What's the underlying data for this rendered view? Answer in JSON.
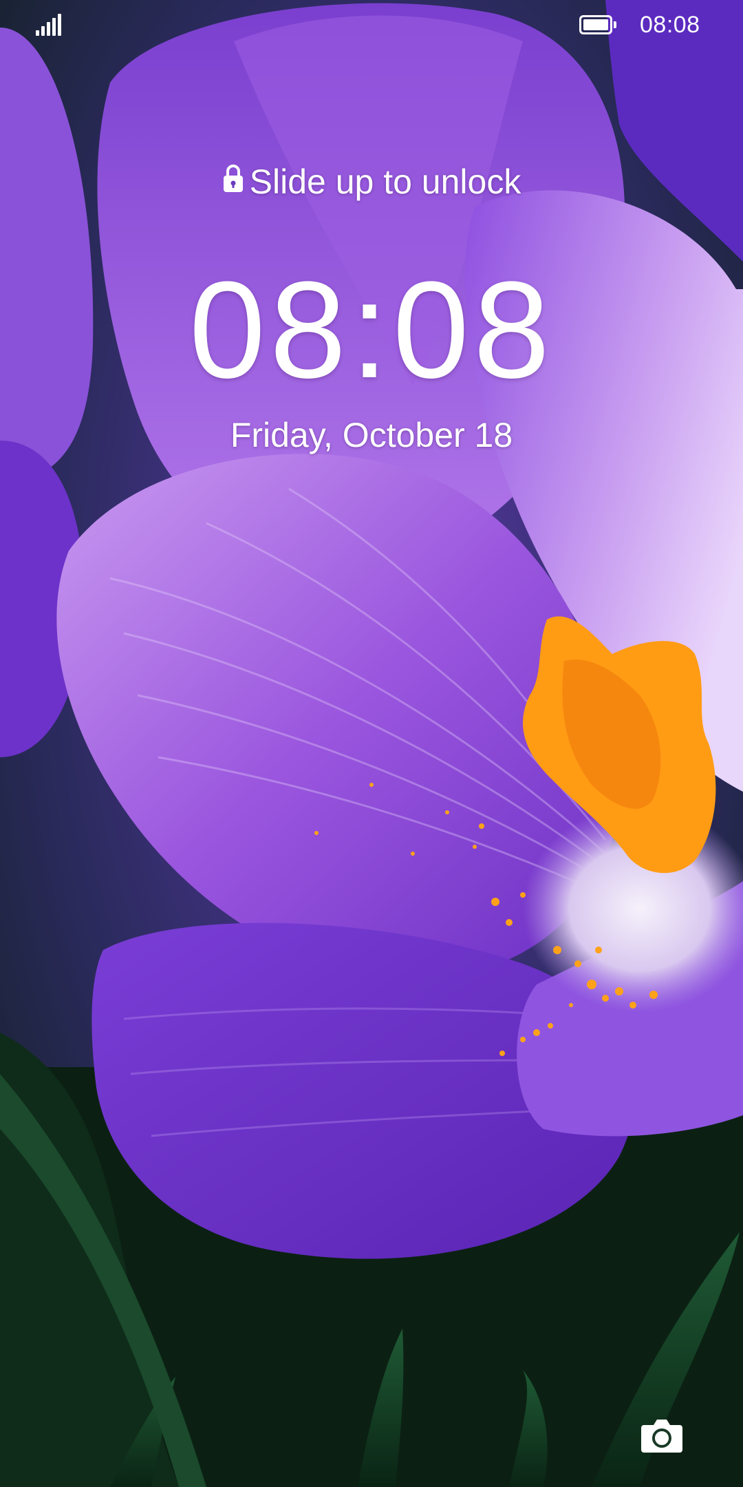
{
  "status_bar": {
    "signal_icon": "signal-strength-icon",
    "battery_icon": "battery-full-icon",
    "battery_level": 1.0,
    "time": "08:08"
  },
  "lock_screen": {
    "unlock_hint": "Slide up to unlock",
    "lock_icon": "lock-icon",
    "clock": "08:08",
    "date": "Friday, October 18"
  },
  "wallpaper": {
    "subject": "purple crocus flower",
    "colors": {
      "petal": "#9b5fe0",
      "petal_light": "#d7b6f5",
      "stamen": "#ff9f1a",
      "leaves": "#12301c"
    }
  },
  "camera_shortcut": {
    "icon": "camera-icon"
  }
}
